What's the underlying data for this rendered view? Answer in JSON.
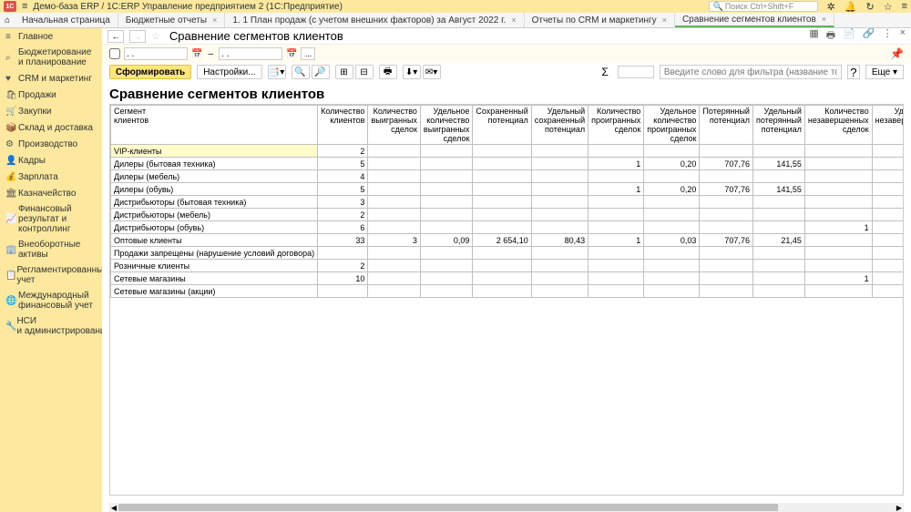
{
  "titlebar": {
    "logo": "1C",
    "title": "Демо-база ERP / 1С:ERP Управление предприятием 2  (1С:Предприятие)",
    "search_placeholder": "Поиск Ctrl+Shift+F"
  },
  "tabs": {
    "home": "Начальная страница",
    "items": [
      {
        "label": "Бюджетные отчеты"
      },
      {
        "label": "1. 1 План продаж (с учетом внешних факторов) за Август 2022 г."
      },
      {
        "label": "Отчеты по CRM и маркетингу"
      },
      {
        "label": "Сравнение сегментов клиентов",
        "active": true
      }
    ]
  },
  "sidebar": {
    "items": [
      {
        "label": "Главное",
        "icon": "≡"
      },
      {
        "label": "Бюджетирование и планирование",
        "icon": "⌕"
      },
      {
        "label": "CRM и маркетинг",
        "icon": "♥"
      },
      {
        "label": "Продажи",
        "icon": "🛍"
      },
      {
        "label": "Закупки",
        "icon": "🛒"
      },
      {
        "label": "Склад и доставка",
        "icon": "📦"
      },
      {
        "label": "Производство",
        "icon": "⚙"
      },
      {
        "label": "Кадры",
        "icon": "👤"
      },
      {
        "label": "Зарплата",
        "icon": "💰"
      },
      {
        "label": "Казначейство",
        "icon": "🏛"
      },
      {
        "label": "Финансовый результат и контроллинг",
        "icon": "📈"
      },
      {
        "label": "Внеоборотные активы",
        "icon": "🏢"
      },
      {
        "label": "Регламентированный учет",
        "icon": "📋"
      },
      {
        "label": "Международный финансовый учет",
        "icon": "🌐"
      },
      {
        "label": "НСИ и администрирование",
        "icon": "🔧"
      }
    ]
  },
  "page": {
    "title": "Сравнение сегментов клиентов",
    "report_title": "Сравнение сегментов клиентов",
    "date_from": ". .",
    "date_to": ". .",
    "date_sep": "–",
    "dots": "...",
    "form_btn": "Сформировать",
    "settings_btn": "Настройки...",
    "filter_placeholder": "Введите слово для фильтра (название товара, покупателя и т...",
    "more_btn": "Еще"
  },
  "grid": {
    "cols": [
      "Сегмент клиентов",
      "Количество клиентов",
      "Количество выигранных сделок",
      "Удельное количество выигранных сделок",
      "Сохраненный потенциал",
      "Удельный сохраненный потенциал",
      "Количество проигранных сделок",
      "Удельное количество проигранных сделок",
      "Потерянный потенциал",
      "Удельный потерянный потенциал",
      "Количество незавершенных сделок",
      "Удельное незавершение сделок"
    ],
    "rows": [
      {
        "c0": "VIP-клиенты",
        "c1": "2",
        "c2": "",
        "c3": "",
        "c4": "",
        "c5": "",
        "c6": "",
        "c7": "",
        "c8": "",
        "c9": "",
        "c10": "",
        "c11": "",
        "hl": true
      },
      {
        "c0": "Дилеры (бытовая техника)",
        "c1": "5",
        "c2": "",
        "c3": "",
        "c4": "",
        "c5": "",
        "c6": "1",
        "c7": "0,20",
        "c8": "707,76",
        "c9": "141,55",
        "c10": "",
        "c11": ""
      },
      {
        "c0": "Дилеры (мебель)",
        "c1": "4",
        "c2": "",
        "c3": "",
        "c4": "",
        "c5": "",
        "c6": "",
        "c7": "",
        "c8": "",
        "c9": "",
        "c10": "",
        "c11": ""
      },
      {
        "c0": "Дилеры (обувь)",
        "c1": "5",
        "c2": "",
        "c3": "",
        "c4": "",
        "c5": "",
        "c6": "1",
        "c7": "0,20",
        "c8": "707,76",
        "c9": "141,55",
        "c10": "",
        "c11": ""
      },
      {
        "c0": "Дистрибьюторы (бытовая техника)",
        "c1": "3",
        "c2": "",
        "c3": "",
        "c4": "",
        "c5": "",
        "c6": "",
        "c7": "",
        "c8": "",
        "c9": "",
        "c10": "",
        "c11": ""
      },
      {
        "c0": "Дистрибьюторы (мебель)",
        "c1": "2",
        "c2": "",
        "c3": "",
        "c4": "",
        "c5": "",
        "c6": "",
        "c7": "",
        "c8": "",
        "c9": "",
        "c10": "",
        "c11": ""
      },
      {
        "c0": "Дистрибьюторы (обувь)",
        "c1": "6",
        "c2": "",
        "c3": "",
        "c4": "",
        "c5": "",
        "c6": "",
        "c7": "",
        "c8": "",
        "c9": "",
        "c10": "1",
        "c11": ""
      },
      {
        "c0": "Оптовые клиенты",
        "c1": "33",
        "c2": "3",
        "c3": "0,09",
        "c4": "2 654,10",
        "c5": "80,43",
        "c6": "1",
        "c7": "0,03",
        "c8": "707,76",
        "c9": "21,45",
        "c10": "",
        "c11": ""
      },
      {
        "c0": "Продажи запрещены (нарушение условий договора)",
        "c1": "",
        "c2": "",
        "c3": "",
        "c4": "",
        "c5": "",
        "c6": "",
        "c7": "",
        "c8": "",
        "c9": "",
        "c10": "",
        "c11": ""
      },
      {
        "c0": "Розничные клиенты",
        "c1": "2",
        "c2": "",
        "c3": "",
        "c4": "",
        "c5": "",
        "c6": "",
        "c7": "",
        "c8": "",
        "c9": "",
        "c10": "",
        "c11": ""
      },
      {
        "c0": "Сетевые магазины",
        "c1": "10",
        "c2": "",
        "c3": "",
        "c4": "",
        "c5": "",
        "c6": "",
        "c7": "",
        "c8": "",
        "c9": "",
        "c10": "1",
        "c11": ""
      },
      {
        "c0": "Сетевые магазины (акции)",
        "c1": "",
        "c2": "",
        "c3": "",
        "c4": "",
        "c5": "",
        "c6": "",
        "c7": "",
        "c8": "",
        "c9": "",
        "c10": "",
        "c11": ""
      }
    ]
  }
}
